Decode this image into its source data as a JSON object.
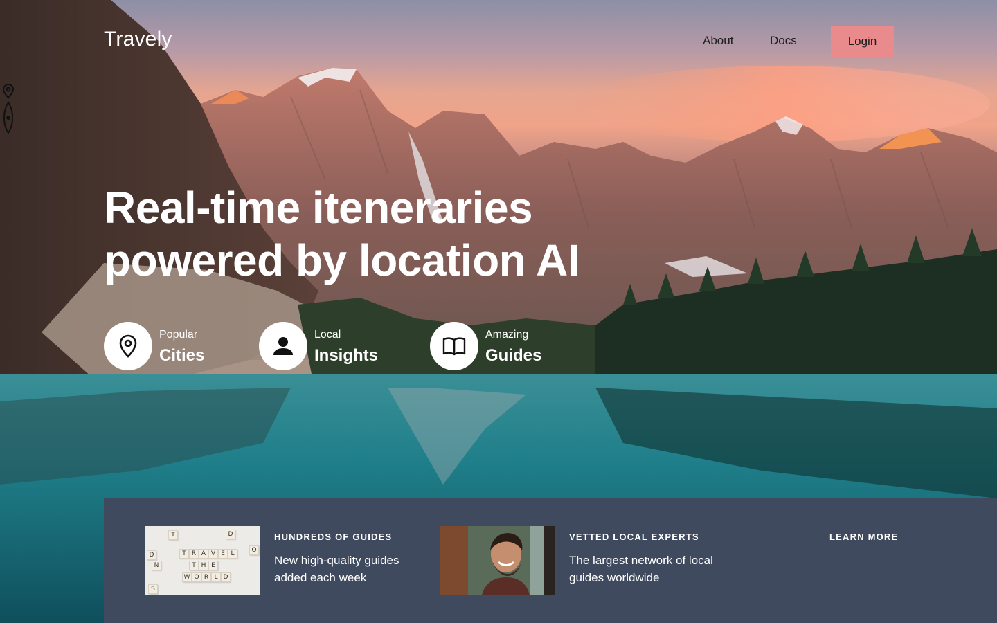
{
  "nav": {
    "brand": "Travely",
    "links": [
      {
        "label": "About"
      },
      {
        "label": "Docs"
      }
    ],
    "login_label": "Login"
  },
  "hero": {
    "headline_line1": "Real-time iteneraries",
    "headline_line2": "powered by location AI"
  },
  "features": [
    {
      "small": "Popular",
      "big": "Cities",
      "icon": "map-pin-icon"
    },
    {
      "small": "Local",
      "big": "Insights",
      "icon": "user-icon"
    },
    {
      "small": "Amazing",
      "big": "Guides",
      "icon": "book-icon"
    }
  ],
  "panel": {
    "cards": [
      {
        "title": "HUNDREDS OF GUIDES",
        "text": "New high-quality guides added each week",
        "image": "scrabble-tiles-image"
      },
      {
        "title": "VETTED LOCAL EXPERTS",
        "text": "The largest network of local guides worldwide",
        "image": "smiling-man-image"
      }
    ],
    "learn_more": "LEARN MORE",
    "tiles": [
      "T",
      "D",
      "D",
      "N",
      "T",
      "R",
      "A",
      "V",
      "E",
      "L",
      "T",
      "H",
      "E",
      "W",
      "O",
      "R",
      "L",
      "D",
      "O",
      "S"
    ]
  },
  "colors": {
    "login_bg": "#e98a8c",
    "panel_bg": "#404a5f",
    "text_light": "#ffffff"
  }
}
